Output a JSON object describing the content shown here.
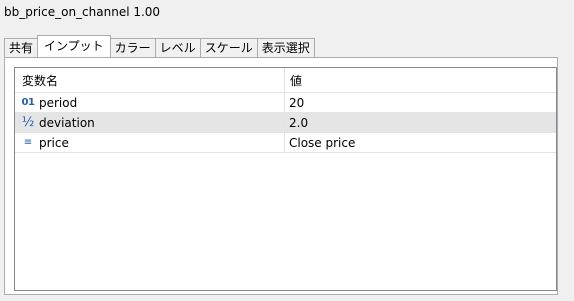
{
  "window": {
    "title": "bb_price_on_channel 1.00"
  },
  "tabs": [
    {
      "label": "共有"
    },
    {
      "label": "インプット"
    },
    {
      "label": "カラー"
    },
    {
      "label": "レベル"
    },
    {
      "label": "スケール"
    },
    {
      "label": "表示選択"
    }
  ],
  "active_tab": "インプット",
  "table": {
    "columns": [
      "変数名",
      "値"
    ],
    "rows": [
      {
        "icon": "integer-icon",
        "icon_glyph": "01",
        "name": "period",
        "value": "20"
      },
      {
        "icon": "fraction-icon",
        "icon_glyph": "½",
        "name": "deviation",
        "value": "2.0"
      },
      {
        "icon": "list-icon",
        "icon_glyph": "≡",
        "name": "price",
        "value": "Close price"
      }
    ]
  },
  "colors": {
    "icon": "#1f5fb3",
    "selected_row": "#e5e5e5",
    "border": "#adadad"
  }
}
